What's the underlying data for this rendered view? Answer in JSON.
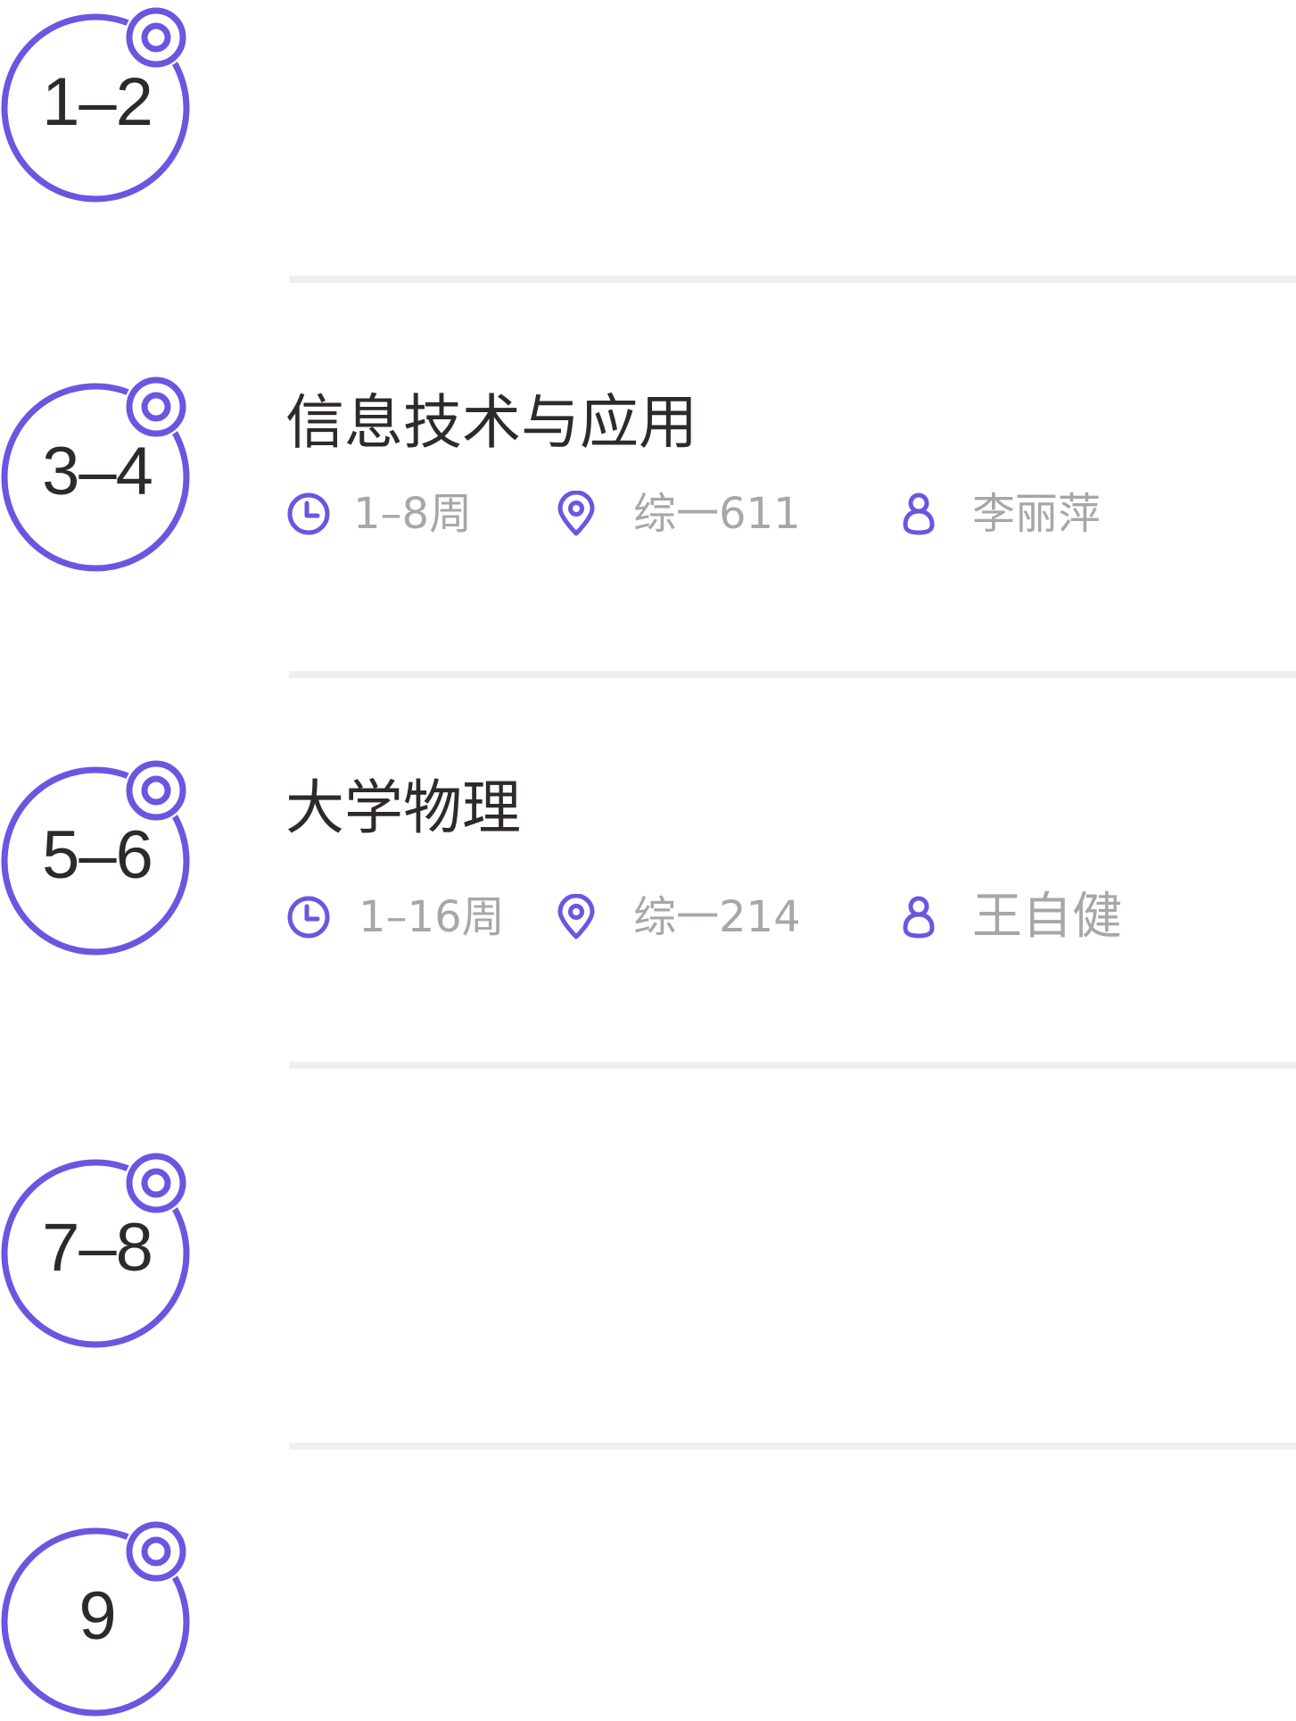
{
  "theme": {
    "accent": "#6a56e0",
    "text_primary": "#2e2a29",
    "text_secondary": "#a9a7a6",
    "divider": "#efefef"
  },
  "periods": [
    {
      "label": "1–2"
    },
    {
      "label": "3–4",
      "course": {
        "name": "信息技术与应用",
        "weeks": "1–8周",
        "room": "综一611",
        "teacher": "李丽萍"
      }
    },
    {
      "label": "5–6",
      "course": {
        "name": "大学物理",
        "weeks": "1–16周",
        "room": "综一214",
        "teacher": "王自健"
      }
    },
    {
      "label": "7–8"
    },
    {
      "label": "9"
    }
  ],
  "icons": {
    "weeks": "clock-icon",
    "room": "location-pin-icon",
    "teacher": "person-icon"
  }
}
